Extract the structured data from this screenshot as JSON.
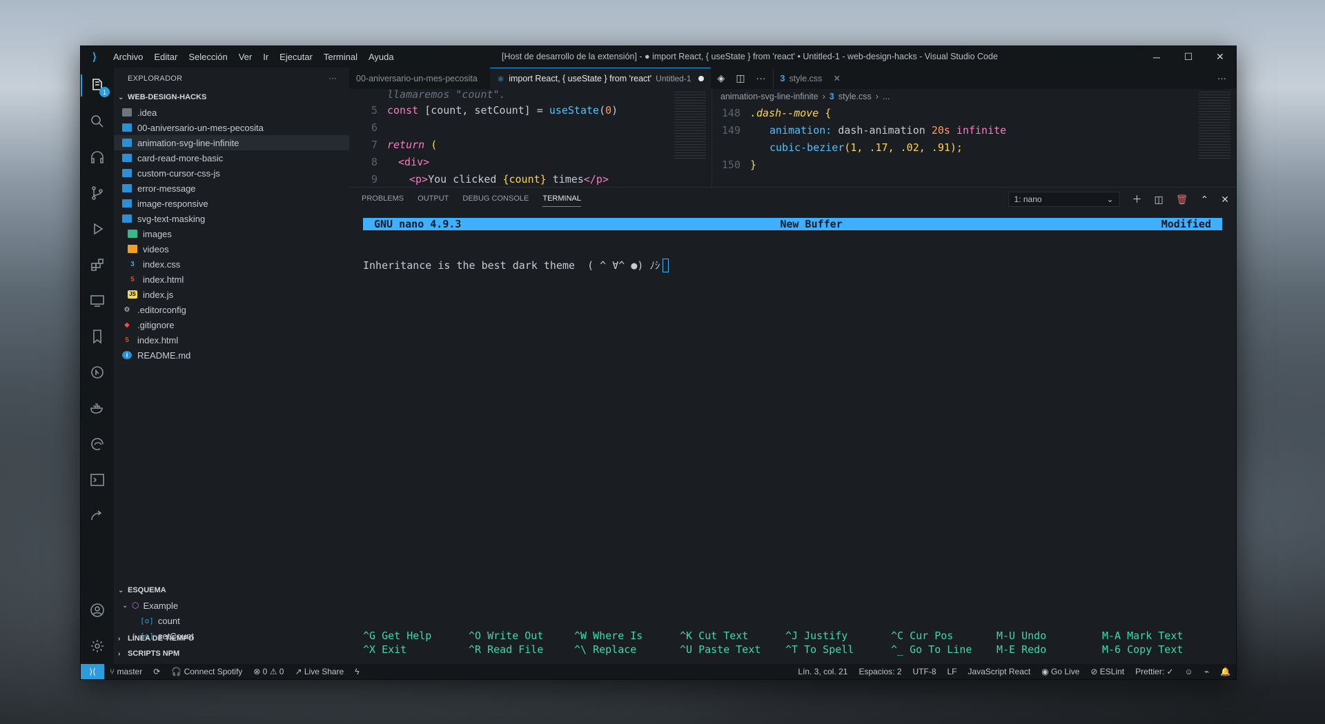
{
  "window": {
    "title": "[Host de desarrollo de la extensión] - ● import React, { useState } from 'react' • Untitled-1 - web-design-hacks - Visual Studio Code",
    "menu": [
      "Archivo",
      "Editar",
      "Selección",
      "Ver",
      "Ir",
      "Ejecutar",
      "Terminal",
      "Ayuda"
    ]
  },
  "activity": {
    "explorer_badge": "1"
  },
  "sidebar": {
    "header": "EXPLORADOR",
    "workspace": "WEB-DESIGN-HACKS",
    "items": [
      {
        "label": ".idea"
      },
      {
        "label": "00-aniversario-un-mes-pecosita"
      },
      {
        "label": "animation-svg-line-infinite"
      },
      {
        "label": "card-read-more-basic"
      },
      {
        "label": "custom-cursor-css-js"
      },
      {
        "label": "error-message"
      },
      {
        "label": "image-responsive"
      },
      {
        "label": "svg-text-masking"
      },
      {
        "label": "images"
      },
      {
        "label": "videos"
      },
      {
        "label": "index.css"
      },
      {
        "label": "index.html"
      },
      {
        "label": "index.js"
      },
      {
        "label": ".editorconfig"
      },
      {
        "label": ".gitignore"
      },
      {
        "label": "index.html"
      },
      {
        "label": "README.md"
      }
    ],
    "outline": {
      "header": "ESQUEMA",
      "root": "Example",
      "children": [
        "count",
        "setCount"
      ]
    },
    "timeline": "LÍNEA DE TIEMPO",
    "npm": "SCRIPTS NPM"
  },
  "tabs": {
    "left_inactive": "00-aniversario-un-mes-pecosita",
    "active_label": "import React, { useState } from 'react'",
    "active_file": "Untitled-1",
    "right_label": "style.css"
  },
  "breadcrumb": {
    "folder": "animation-svg-line-infinite",
    "file": "style.css",
    "rest": "..."
  },
  "code_left": {
    "comment": "llamaremos \"count\".",
    "lines": [
      {
        "n": "5"
      },
      {
        "n": "6"
      },
      {
        "n": "7"
      },
      {
        "n": "8"
      },
      {
        "n": "9"
      }
    ],
    "l5_const": "const ",
    "l5_a": "[count, setCount]",
    "l5_eq": " = ",
    "l5_fn": "useState",
    "l5_p1": "(",
    "l5_zero": "0",
    "l5_p2": ")",
    "l7_ret": "return",
    "l7_paren": " (",
    "l8_tag": "<div>",
    "l9_open": "<p>",
    "l9_text": "You clicked ",
    "l9_expr": "{count}",
    "l9_text2": " times",
    "l9_close": "</p>"
  },
  "code_right": {
    "lines": [
      {
        "n": "148"
      },
      {
        "n": "149"
      },
      {
        "n": "150"
      }
    ],
    "l148_sel": ".dash--move",
    "l148_brace": " {",
    "l149_prop": "animation:",
    "l149_name": " dash-animation ",
    "l149_num": "20s",
    "l149_kw": " infinite",
    "l149b_fn": "cubic-bezier",
    "l149b_args": "(1, .17, .02, .91);",
    "l150_brace": "}"
  },
  "panel": {
    "tabs": [
      "PROBLEMS",
      "OUTPUT",
      "DEBUG CONSOLE",
      "TERMINAL"
    ],
    "terminal_select": "1: nano"
  },
  "nano": {
    "left": "GNU nano 4.9.3",
    "center": "New Buffer",
    "right": "Modified",
    "text": "Inheritance is the best dark theme  ( ^ ∀^ ●) ﾉｼ",
    "keys": [
      "^G Get Help",
      "^O Write Out",
      "^W Where Is",
      "^K Cut Text",
      "^J Justify",
      "^C Cur Pos",
      "M-U Undo",
      "M-A Mark Text",
      "^X Exit",
      "^R Read File",
      "^\\ Replace",
      "^U Paste Text",
      "^T To Spell",
      "^_ Go To Line",
      "M-E Redo",
      "M-6 Copy Text"
    ]
  },
  "status": {
    "branch": "master",
    "spotify": "Connect Spotify",
    "problems": "⊗ 0 ⚠ 0",
    "liveshare": "Live Share",
    "position": "Lín. 3, col. 21",
    "spaces": "Espacios: 2",
    "encoding": "UTF-8",
    "eol": "LF",
    "language": "JavaScript React",
    "golive": "Go Live",
    "eslint": "ESLint",
    "prettier": "Prettier: ✓"
  }
}
